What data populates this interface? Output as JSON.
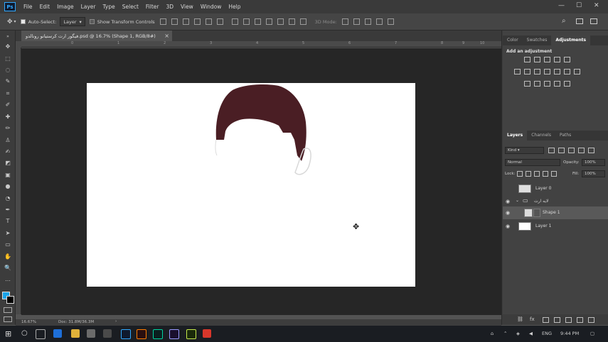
{
  "app": {
    "logo": "Ps"
  },
  "menu": [
    "File",
    "Edit",
    "Image",
    "Layer",
    "Type",
    "Select",
    "Filter",
    "3D",
    "View",
    "Window",
    "Help"
  ],
  "window_controls": {
    "minimize": "—",
    "maximize": "☐",
    "close": "✕"
  },
  "options": {
    "auto_select_label": "Auto-Select:",
    "auto_select_value": "Layer",
    "show_transform_label": "Show Transform Controls",
    "mode_3d_label": "3D Mode:"
  },
  "document_tab": {
    "title": "فیگور ارت کرستیانو رونالدو.psd @ 16.7% (Shape 1, RGB/8#)",
    "close": "×"
  },
  "ruler_ticks": [
    "0",
    "1",
    "2",
    "3",
    "4",
    "5",
    "6",
    "7",
    "8",
    "9",
    "10"
  ],
  "status": {
    "zoom": "16.67%",
    "doc": "Doc: 31.8M/36.3M",
    "arrow": "›"
  },
  "panels": {
    "top_tabs": [
      "Color",
      "Swatches",
      "Adjustments"
    ],
    "adjust_header": "Add an adjustment",
    "layer_tabs": [
      "Layers",
      "Channels",
      "Paths"
    ],
    "kind_label": "Kind",
    "blend_mode": "Normal",
    "opacity_label": "Opacity:",
    "opacity_value": "100%",
    "lock_label": "Lock:",
    "fill_label": "Fill:",
    "fill_value": "100%",
    "layers": [
      {
        "name": "Layer 0",
        "visible": false,
        "selected": false
      },
      {
        "name": "لایه ارت",
        "visible": true,
        "selected": false,
        "group": true
      },
      {
        "name": "Shape 1",
        "visible": true,
        "selected": true
      },
      {
        "name": "Layer 1",
        "visible": true,
        "selected": false
      }
    ]
  },
  "taskbar": {
    "time": "9:44 PM",
    "lang": "ENG"
  },
  "colors": {
    "hair": "#4a1e24",
    "accent": "#31a8ff",
    "foreground": "#1aa3e8",
    "background": "#000000"
  },
  "cursor": "move-cursor-icon"
}
